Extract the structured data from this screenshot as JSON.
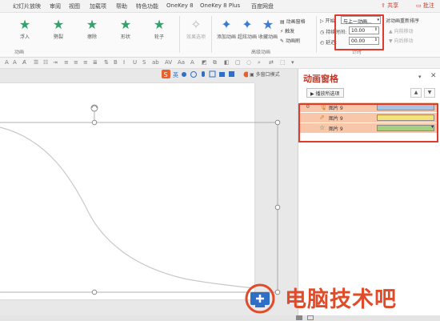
{
  "menu": {
    "items": [
      "幻灯片放映",
      "审阅",
      "视图",
      "加载项",
      "帮助",
      "特色功能",
      "OneKey 8",
      "OneKey 8 Plus",
      "百度网盘"
    ],
    "share": "共享",
    "comment": "批注"
  },
  "ribbon": {
    "effects": [
      {
        "label": "浮入",
        "icon": "float-in-star-icon",
        "disabled": false
      },
      {
        "label": "劈裂",
        "icon": "split-star-icon",
        "disabled": false
      },
      {
        "label": "擦除",
        "icon": "wipe-star-icon",
        "disabled": false
      },
      {
        "label": "形状",
        "icon": "shape-star-icon",
        "disabled": false
      },
      {
        "label": "轮子",
        "icon": "wheel-star-icon",
        "disabled": false
      },
      {
        "label": "效果选项",
        "icon": "effect-options-icon",
        "disabled": true
      },
      {
        "label": "添加动画",
        "icon": "add-animation-icon",
        "disabled": false
      },
      {
        "label": "超炫动画",
        "icon": "super-animation-icon",
        "disabled": false
      },
      {
        "label": "收藏动画",
        "icon": "favorite-animation-icon",
        "disabled": false
      }
    ],
    "group_animation": "动画",
    "group_advanced": "高级动画",
    "group_timing": "计时",
    "anim_pane_cmd": "动画窗格",
    "trigger_cmd": "触发",
    "anim_painter": "动画刷",
    "start_label": "开始:",
    "start_value": "与上一动画...",
    "duration_label": "持续时间:",
    "duration_value": "10.00",
    "delay_label": "延迟:",
    "delay_value": "00.00",
    "reorder_label": "对动画重新排序",
    "move_earlier": "向前移动",
    "move_later": "向后移动"
  },
  "toolbar": {
    "multi_window": "多窗口模式"
  },
  "pane": {
    "title": "动画窗格",
    "play_label": "播放所选项",
    "up": "▲",
    "down": "▼",
    "rows": [
      {
        "num": "0",
        "label": "图片 9",
        "icon": "microphone-icon",
        "icon_glyph": "🎙",
        "bar_color": "#a8c4e0"
      },
      {
        "num": "",
        "label": "图片 9",
        "icon": "path-icon",
        "icon_glyph": "⇗",
        "bar_color": "#f3e27a"
      },
      {
        "num": "",
        "label": "图片 9",
        "icon": "star-icon",
        "icon_glyph": "☆",
        "bar_color": "#a6d07f"
      }
    ]
  },
  "watermark": {
    "text": "电脑技术吧"
  },
  "colors": {
    "accent_red": "#e23a2c",
    "row_highlight": "#f8c6a8",
    "effect_green": "#2ea36b"
  }
}
